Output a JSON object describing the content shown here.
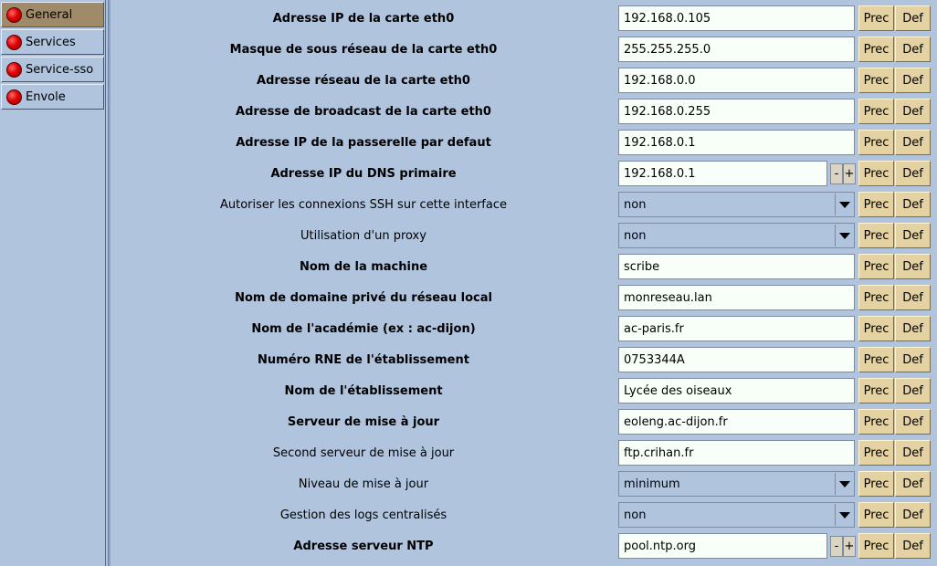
{
  "sidebar": {
    "items": [
      {
        "label": "General",
        "active": true
      },
      {
        "label": "Services",
        "active": false
      },
      {
        "label": "Service-sso",
        "active": false
      },
      {
        "label": "Envole",
        "active": false
      }
    ]
  },
  "buttons": {
    "prec": "Prec",
    "def": "Def",
    "minus": "-",
    "plus": "+"
  },
  "rows": [
    {
      "label": "Adresse IP de la carte eth0",
      "value": "192.168.0.105",
      "type": "text",
      "bold": true
    },
    {
      "label": "Masque de sous réseau de la carte eth0",
      "value": "255.255.255.0",
      "type": "text",
      "bold": true
    },
    {
      "label": "Adresse réseau de la carte eth0",
      "value": "192.168.0.0",
      "type": "text",
      "bold": true
    },
    {
      "label": "Adresse de broadcast de la carte eth0",
      "value": "192.168.0.255",
      "type": "text",
      "bold": true
    },
    {
      "label": "Adresse IP de la passerelle par defaut",
      "value": "192.168.0.1",
      "type": "text",
      "bold": true
    },
    {
      "label": "Adresse IP du DNS primaire",
      "value": "192.168.0.1",
      "type": "multi",
      "bold": true
    },
    {
      "label": "Autoriser les connexions SSH sur cette interface",
      "value": "non",
      "type": "select",
      "bold": false
    },
    {
      "label": "Utilisation d'un proxy",
      "value": "non",
      "type": "select",
      "bold": false
    },
    {
      "label": "Nom de la machine",
      "value": "scribe",
      "type": "text",
      "bold": true
    },
    {
      "label": "Nom de domaine privé du réseau local",
      "value": "monreseau.lan",
      "type": "text",
      "bold": true
    },
    {
      "label": "Nom de l'académie (ex : ac-dijon)",
      "value": "ac-paris.fr",
      "type": "text",
      "bold": true
    },
    {
      "label": "Numéro RNE de l'établissement",
      "value": "0753344A",
      "type": "text",
      "bold": true
    },
    {
      "label": "Nom de l'établissement",
      "value": "Lycée des oiseaux",
      "type": "text",
      "bold": true
    },
    {
      "label": "Serveur de mise à jour",
      "value": "eoleng.ac-dijon.fr",
      "type": "text",
      "bold": true
    },
    {
      "label": "Second serveur de mise à jour",
      "value": "ftp.crihan.fr",
      "type": "text",
      "bold": false
    },
    {
      "label": "Niveau de mise à jour",
      "value": "minimum",
      "type": "select",
      "bold": false
    },
    {
      "label": "Gestion des logs centralisés",
      "value": "non",
      "type": "select",
      "bold": false
    },
    {
      "label": "Adresse serveur NTP",
      "value": "pool.ntp.org",
      "type": "multi",
      "bold": true
    }
  ]
}
